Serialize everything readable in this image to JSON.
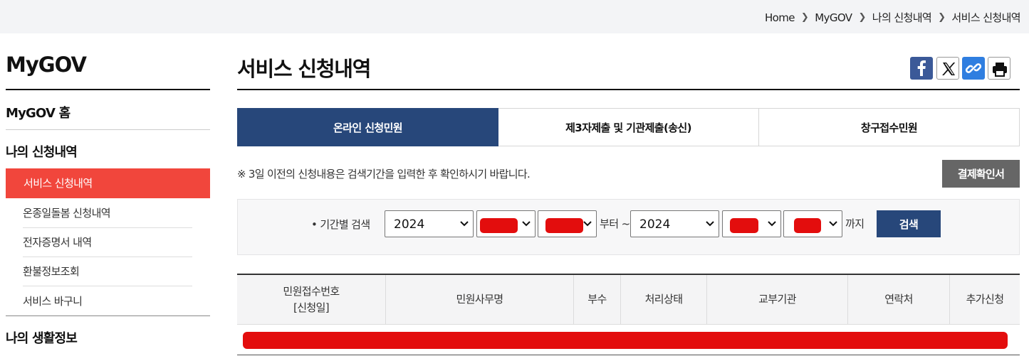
{
  "breadcrumb": [
    "Home",
    "MyGOV",
    "나의 신청내역",
    "서비스 신청내역"
  ],
  "sidebar": {
    "title": "MyGOV",
    "home": "MyGOV 홈",
    "section1": "나의 신청내역",
    "items": [
      "서비스 신청내역",
      "온종일돌봄 신청내역",
      "전자증명서 내역",
      "환불정보조회",
      "서비스 바구니"
    ],
    "section2": "나의 생활정보"
  },
  "page": {
    "title": "서비스 신청내역"
  },
  "share_icons": [
    "facebook-icon",
    "x-icon",
    "link-icon",
    "print-icon"
  ],
  "tabs": [
    "온라인 신청민원",
    "제3자제출 및 기관제출(송신)",
    "창구접수민원"
  ],
  "active_tab": 0,
  "notice": "※ 3일 이전의 신청내용은 검색기간을 입력한 후 확인하시기 바랍니다.",
  "payment_button": "결제확인서",
  "search": {
    "label": "• 기간별 검색",
    "from_year": "2024",
    "from_text": "부터 ~",
    "to_year": "2024",
    "to_text": "까지",
    "button": "검색"
  },
  "table": {
    "headers": [
      "민원접수번호\n[신청일]",
      "민원사무명",
      "부수",
      "처리상태",
      "교부기관",
      "연락처",
      "추가신청"
    ]
  },
  "colors": {
    "navy": "#27477a",
    "active_red": "#f1463c",
    "redaction": "#e30d0d",
    "gray_button": "#666666"
  }
}
